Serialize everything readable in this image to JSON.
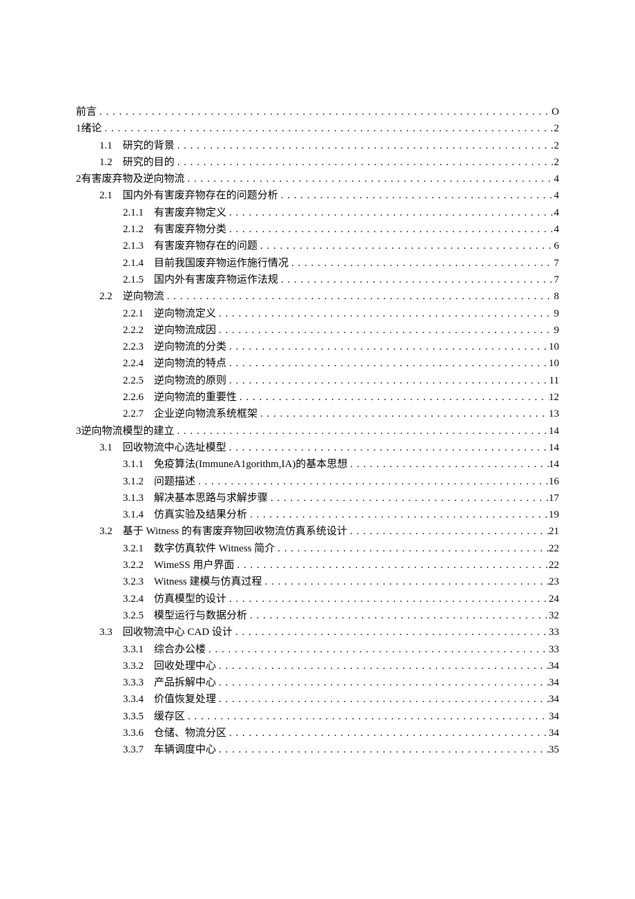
{
  "toc": [
    {
      "level": 0,
      "num": "",
      "numGap": "",
      "title": "前言",
      "titleGap": "",
      "page": "O"
    },
    {
      "level": 0,
      "num": "1",
      "numGap": " ",
      "title": "绪论",
      "titleGap": "",
      "page": "2"
    },
    {
      "level": 1,
      "num": "1.1",
      "numGap": "　",
      "title": "研究的背景",
      "titleGap": "",
      "page": "2"
    },
    {
      "level": 1,
      "num": "1.2",
      "numGap": "　",
      "title": "研究的目的",
      "titleGap": "",
      "page": "2"
    },
    {
      "level": 0,
      "num": "2",
      "numGap": " ",
      "title": "有害废弃物及逆向物流",
      "titleGap": "",
      "page": "4"
    },
    {
      "level": 1,
      "num": "2.1",
      "numGap": "　",
      "title": "国内外有害废弃物存在的问题分析",
      "titleGap": "",
      "page": "4"
    },
    {
      "level": 2,
      "num": "2.1.1",
      "numGap": "　",
      "title": "有害废弃物定义",
      "titleGap": "",
      "page": "4"
    },
    {
      "level": 2,
      "num": "2.1.2",
      "numGap": "　",
      "title": "有害废弃物分类",
      "titleGap": "",
      "page": "4"
    },
    {
      "level": 2,
      "num": "2.1.3",
      "numGap": "　",
      "title": "有害废弃物存在的问题",
      "titleGap": "",
      "page": "6"
    },
    {
      "level": 2,
      "num": "2.1.4",
      "numGap": "　",
      "title": "目前我国废弃物运作施行情况",
      "titleGap": "",
      "page": "7"
    },
    {
      "level": 2,
      "num": "2.1.5",
      "numGap": "　",
      "title": "国内外有害废弃物运作法规",
      "titleGap": "",
      "page": "7"
    },
    {
      "level": 1,
      "num": "2.2",
      "numGap": "　",
      "title": "逆向物流",
      "titleGap": "",
      "page": "8"
    },
    {
      "level": 2,
      "num": "2.2.1",
      "numGap": "　",
      "title": "逆向物流定义",
      "titleGap": "",
      "page": "9"
    },
    {
      "level": 2,
      "num": "2.2.2",
      "numGap": "　",
      "title": "逆向物流成因",
      "titleGap": "",
      "page": "9"
    },
    {
      "level": 2,
      "num": "2.2.3",
      "numGap": "　",
      "title": "逆向物流的分类",
      "titleGap": "",
      "page": "10"
    },
    {
      "level": 2,
      "num": "2.2.4",
      "numGap": "　",
      "title": "逆向物流的特点",
      "titleGap": "",
      "page": "10"
    },
    {
      "level": 2,
      "num": "2.2.5",
      "numGap": "　",
      "title": "逆向物流的原则",
      "titleGap": "",
      "page": "11"
    },
    {
      "level": 2,
      "num": "2.2.6",
      "numGap": "　",
      "title": "逆向物流的重要性",
      "titleGap": "",
      "page": "12"
    },
    {
      "level": 2,
      "num": "2.2.7",
      "numGap": "　",
      "title": "企业逆向物流系统框架",
      "titleGap": "",
      "page": "13"
    },
    {
      "level": 0,
      "num": "3",
      "numGap": " ",
      "title": "逆向物流模型的建立",
      "titleGap": "",
      "page": "14"
    },
    {
      "level": 1,
      "num": "3.1",
      "numGap": "　",
      "title": "回收物流中心选址模型",
      "titleGap": "",
      "page": "14"
    },
    {
      "level": 2,
      "num": "3.1.1",
      "numGap": "　",
      "title": "免疫算法(ImmuneA1gorithm,IA)的基本思想",
      "titleGap": "",
      "page": "14"
    },
    {
      "level": 2,
      "num": "3.1.2",
      "numGap": "　",
      "title": "问题描述",
      "titleGap": "",
      "page": "16"
    },
    {
      "level": 2,
      "num": "3.1.3",
      "numGap": "　",
      "title": "解决基本思路与求解步骤",
      "titleGap": "",
      "page": "17"
    },
    {
      "level": 2,
      "num": "3.1.4",
      "numGap": "　",
      "title": "仿真实验及结果分析",
      "titleGap": "",
      "page": "19"
    },
    {
      "level": 1,
      "num": "3.2",
      "numGap": "　",
      "title": "基于 Witness 的有害废弃物回收物流仿真系统设计",
      "titleGap": "",
      "page": "21"
    },
    {
      "level": 2,
      "num": "3.2.1",
      "numGap": "　",
      "title": "数字仿真软件 Witness 简介",
      "titleGap": "",
      "page": "22"
    },
    {
      "level": 2,
      "num": "3.2.2",
      "numGap": "　",
      "title": "WimeSS 用户界面",
      "titleGap": "",
      "page": "22"
    },
    {
      "level": 2,
      "num": "3.2.3",
      "numGap": "　",
      "title": "Witness 建模与仿真过程",
      "titleGap": "",
      "page": "23"
    },
    {
      "level": 2,
      "num": "3.2.4",
      "numGap": "　",
      "title": "仿真模型的设计",
      "titleGap": "",
      "page": "24"
    },
    {
      "level": 2,
      "num": "3.2.5",
      "numGap": "　",
      "title": "模型运行与数据分析",
      "titleGap": "",
      "page": "32"
    },
    {
      "level": 1,
      "num": "3.3",
      "numGap": "　",
      "title": "回收物流中心 CAD 设计",
      "titleGap": "",
      "page": "33"
    },
    {
      "level": 2,
      "num": "3.3.1",
      "numGap": "　",
      "title": "综合办公楼",
      "titleGap": "",
      "page": "33"
    },
    {
      "level": 2,
      "num": "3.3.2",
      "numGap": "　",
      "title": "回收处理中心",
      "titleGap": "",
      "page": "34"
    },
    {
      "level": 2,
      "num": "3.3.3",
      "numGap": "　",
      "title": "产品拆解中心",
      "titleGap": "",
      "page": "34"
    },
    {
      "level": 2,
      "num": "3.3.4",
      "numGap": "　",
      "title": "价值恢复处理",
      "titleGap": "",
      "page": "34"
    },
    {
      "level": 2,
      "num": "3.3.5",
      "numGap": "　",
      "title": "缓存区",
      "titleGap": "",
      "page": "34"
    },
    {
      "level": 2,
      "num": "3.3.6",
      "numGap": "　",
      "title": "仓储、物流分区",
      "titleGap": "",
      "page": "34"
    },
    {
      "level": 2,
      "num": "3.3.7",
      "numGap": "　",
      "title": "车辆调度中心",
      "titleGap": "",
      "page": "35"
    }
  ]
}
